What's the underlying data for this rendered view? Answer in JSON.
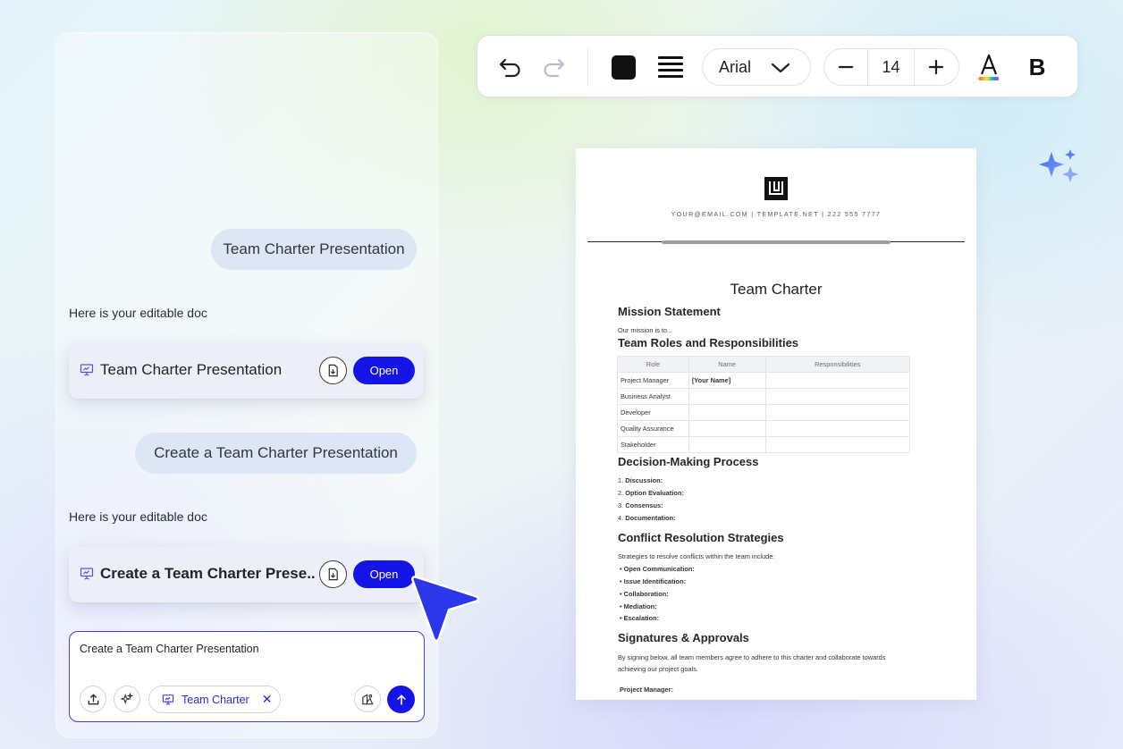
{
  "chat": {
    "messages": [
      {
        "role": "user",
        "text": "Team Charter Presentation"
      },
      {
        "role": "assistant",
        "text": "Here is your editable doc"
      },
      {
        "role": "user",
        "text": "Create a Team Charter Presentation"
      },
      {
        "role": "assistant",
        "text": "Here is your editable doc"
      }
    ],
    "cards": [
      {
        "title": "Team Charter Presentation",
        "open_label": "Open"
      },
      {
        "title": "Create a Team Charter Prese...",
        "open_label": "Open"
      }
    ],
    "composer": {
      "input_value": "Create a Team Charter Presentation",
      "chip_label": "Team Charter",
      "chip_close": "✕"
    }
  },
  "toolbar": {
    "font_family": "Arial",
    "font_size": "14",
    "bold_label": "B",
    "text_color_label": "A",
    "color_swatch": "#111111"
  },
  "colors": {
    "accent": "#1414e6",
    "bubble": "#dde6f5",
    "cursor": "#2d37ea"
  },
  "document": {
    "contact": "YOUR@EMAIL.COM | TEMPLATE.NET | 222 555 7777",
    "title": "Team Charter",
    "mission": {
      "heading": "Mission Statement",
      "text": "Our mission is to..."
    },
    "roles": {
      "heading": "Team Roles and Responsibilities",
      "columns": [
        "Role",
        "Name",
        "Responsibilities"
      ],
      "rows": [
        [
          "Project Manager",
          "[Your Name]",
          ""
        ],
        [
          "Business Analyst",
          "",
          ""
        ],
        [
          "Developer",
          "",
          ""
        ],
        [
          "Quality Assurance",
          "",
          ""
        ],
        [
          "Stakeholder",
          "",
          ""
        ]
      ]
    },
    "decision": {
      "heading": "Decision-Making Process",
      "items": [
        {
          "num": "1.",
          "label": "Discussion:"
        },
        {
          "num": "2.",
          "label": "Option Evaluation:"
        },
        {
          "num": "3.",
          "label": "Consensus:"
        },
        {
          "num": "4.",
          "label": "Documentation:"
        }
      ]
    },
    "conflict": {
      "heading": "Conflict Resolution Strategies",
      "intro": "Strategies to resolve conflicts within the team include:",
      "items": [
        "• Open Communication:",
        "• Issue Identification:",
        "• Collaboration:",
        "• Mediation:",
        "• Escalation:"
      ]
    },
    "signatures": {
      "heading": "Signatures & Approvals",
      "line1": "By signing below, all team members agree to adhere to this charter and collaborate towards",
      "line2": "achieving our project goals.",
      "partial": "Project Manager:"
    }
  }
}
